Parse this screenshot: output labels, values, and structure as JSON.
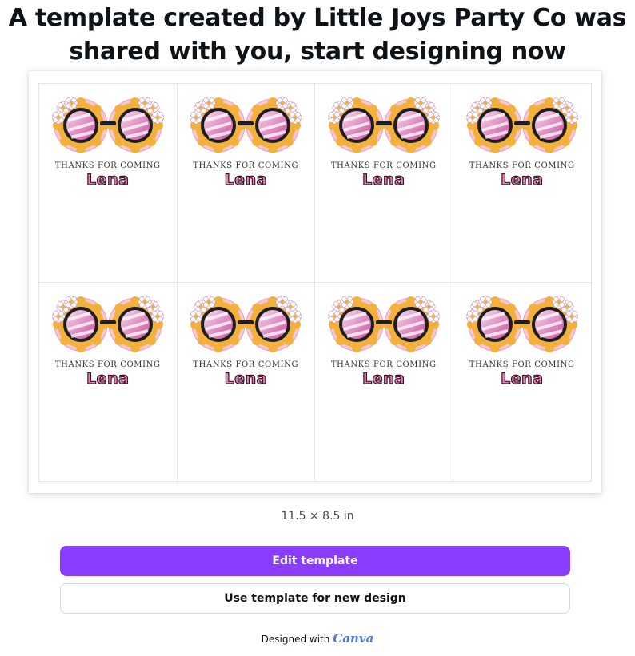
{
  "header": {
    "title_line1": "A template created by Little Joys Party Co was",
    "title_line2": "shared with you, start designing now"
  },
  "preview": {
    "tags": [
      {
        "thanks": "THANKS FOR COMING",
        "name": "Lena"
      },
      {
        "thanks": "THANKS FOR COMING",
        "name": "Lena"
      },
      {
        "thanks": "THANKS FOR COMING",
        "name": "Lena"
      },
      {
        "thanks": "THANKS FOR COMING",
        "name": "Lena"
      },
      {
        "thanks": "THANKS FOR COMING",
        "name": "Lena"
      },
      {
        "thanks": "THANKS FOR COMING",
        "name": "Lena"
      },
      {
        "thanks": "THANKS FOR COMING",
        "name": "Lena"
      },
      {
        "thanks": "THANKS FOR COMING",
        "name": "Lena"
      }
    ],
    "icon": "flower-sunglasses-icon",
    "size_label": "11.5 × 8.5 in"
  },
  "actions": {
    "edit_label": "Edit template",
    "use_label": "Use template for new design"
  },
  "footer": {
    "designed_with": "Designed with",
    "brand": "Canva"
  },
  "colors": {
    "primary": "#8b3dff",
    "name_pink": "#f27bb6",
    "petal_orange": "#f3b13c",
    "petal_pink": "#f7c7d6"
  }
}
